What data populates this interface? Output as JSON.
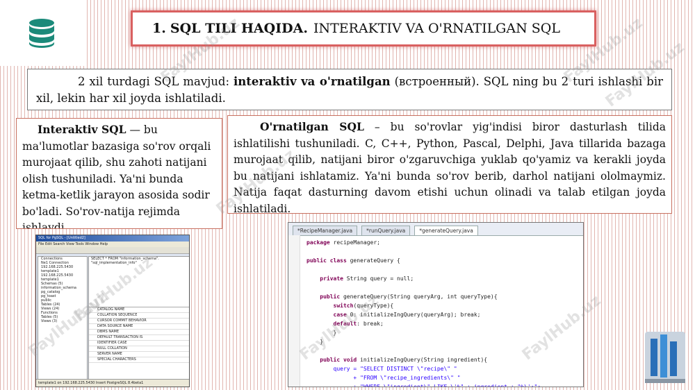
{
  "title": {
    "number": "1.",
    "bold": "SQL TILI HAQIDA.",
    "rest": "INTERAKTIV VA O'RNATILGAN SQL"
  },
  "intro": {
    "text_a": "2 xil turdagi SQL mavjud: ",
    "text_bold": "interaktiv va o'rnatilgan",
    "text_b": " (встроенный). SQL ning bu 2 turi ishlashi bir xil, lekin har xil joyda ishlatiladi."
  },
  "interactive": {
    "lead": "Interaktiv SQL",
    "text": " — bu ma'lumotlar bazasiga so'rov orqali murojaat qilib, shu zahoti natijani olish tushuniladi. Ya'ni bunda ketma-ketlik jarayon asosida sodir bo'ladi. So'rov-natija rejimda ishlaydi."
  },
  "embedded": {
    "lead": "O'rnatilgan SQL",
    "text": " – bu so'rovlar yig'indisi biror dasturlash tilida ishlatilishi tushuniladi. C, C++, Python, Pascal, Delphi, Java tillarida bazaga murojaat qilib, natijani biror o'zgaruvchiga yuklab qo'yamiz va kerakli joyda bu natijani ishlatamiz. Ya'ni bunda so'rov berib, darhol natijani ololmaymiz. Natija faqat dasturning davom etishi uchun olinadi va talab etilgan joyda ishlatiladi."
  },
  "screenshot1": {
    "window_title": "SQL for PgSQL - [Untitled2]",
    "menu": "File  Edit  Search  View  Tools  Window  Help",
    "tree": [
      "Connections",
      "Ne1 Connection",
      "192.168.225.5430",
      "template1",
      "192.168.225.5430",
      "template1",
      "Schemas (5)",
      "information_schema",
      "pg_catalog",
      "pg_toast",
      "public",
      "Tables (24)",
      "Views (24)",
      "Functions",
      "Tables (5)",
      "Views (3)"
    ],
    "query_line1": "SELECT * FROM \"information_schema\".",
    "query_line2": "\"sql_implementation_info\"",
    "rows": [
      "CATALOG NAME",
      "COLLATION SEQUENCE",
      "CURSOR COMMIT BEHAVIOR",
      "DATA SOURCE NAME",
      "DBMS NAME",
      "DEFAULT TRANSACTION IS",
      "IDENTIFIER CASE",
      "NULL COLLATION",
      "SERVER NAME",
      "SPECIAL CHARACTERS"
    ],
    "status": "template1 on 192.168.225.5430   Insert   PostgreSQL 8.4beta1"
  },
  "screenshot2": {
    "tabs": [
      "*RecipeManager.java",
      "*runQuery.java",
      "*generateQuery.java"
    ],
    "code": [
      {
        "k": "package",
        "t": " recipeManager;"
      },
      {
        "k": "",
        "t": ""
      },
      {
        "k": "public class",
        "t": " generateQuery {"
      },
      {
        "k": "",
        "t": ""
      },
      {
        "k": "    private",
        "t": " String query = null;"
      },
      {
        "k": "",
        "t": ""
      },
      {
        "k": "    public",
        "t": " generateQuery(String queryArg, int queryType){"
      },
      {
        "k": "        switch",
        "t": "(queryType){"
      },
      {
        "k": "        case",
        "t": " 0: initializeIngQuery(queryArg); break;"
      },
      {
        "k": "        default",
        "t": ": break;"
      },
      {
        "k": "",
        "t": "        }"
      },
      {
        "k": "",
        "t": "    }"
      },
      {
        "k": "",
        "t": ""
      },
      {
        "k": "    public void",
        "t": " initializeIngQuery(String ingredient){"
      },
      {
        "k": "",
        "t": "        query = \"SELECT DISTINCT \\\"recipe\\\" \""
      },
      {
        "k": "",
        "t": "              + \"FROM \\\"recipe_ingredients\\\" \""
      },
      {
        "k": "",
        "t": "              + \"WHERE \\\"ingredient\\\" LIKE \\'%\" + ingredient + \"%\\';\";"
      }
    ]
  },
  "watermark": "FaylHub.uz",
  "colors": {
    "border_red": "#d96060",
    "accent_teal": "#1b8a7a"
  }
}
